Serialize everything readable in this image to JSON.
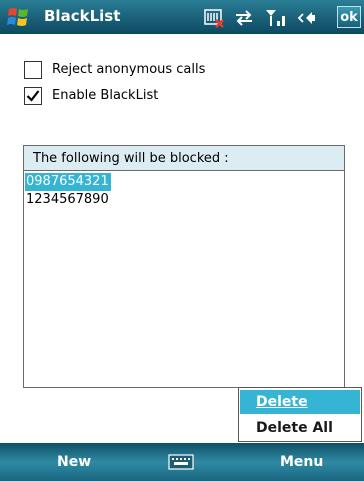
{
  "title_bar": {
    "title": "BlackList",
    "ok_label": "ok",
    "icons": [
      "windows-start-icon",
      "sim-card-icon",
      "data-connection-icon",
      "signal-strength-icon",
      "speaker-icon"
    ]
  },
  "options": {
    "reject_anonymous": {
      "label": "Reject anonymous calls",
      "checked": false
    },
    "enable_blacklist": {
      "label": "Enable BlackList",
      "checked": true
    }
  },
  "blocked_list": {
    "header": "The following will be blocked :",
    "items": [
      {
        "number": "0987654321",
        "selected": true
      },
      {
        "number": "1234567890",
        "selected": false
      }
    ]
  },
  "popup_menu": {
    "items": [
      {
        "label": "Delete",
        "highlighted": true
      },
      {
        "label": "Delete All",
        "highlighted": false
      }
    ]
  },
  "softkeys": {
    "left": "New",
    "right": "Menu"
  },
  "colors": {
    "title_bar": "#1a5f78",
    "selection": "#36b4d4",
    "list_header": "#dcecf3"
  }
}
